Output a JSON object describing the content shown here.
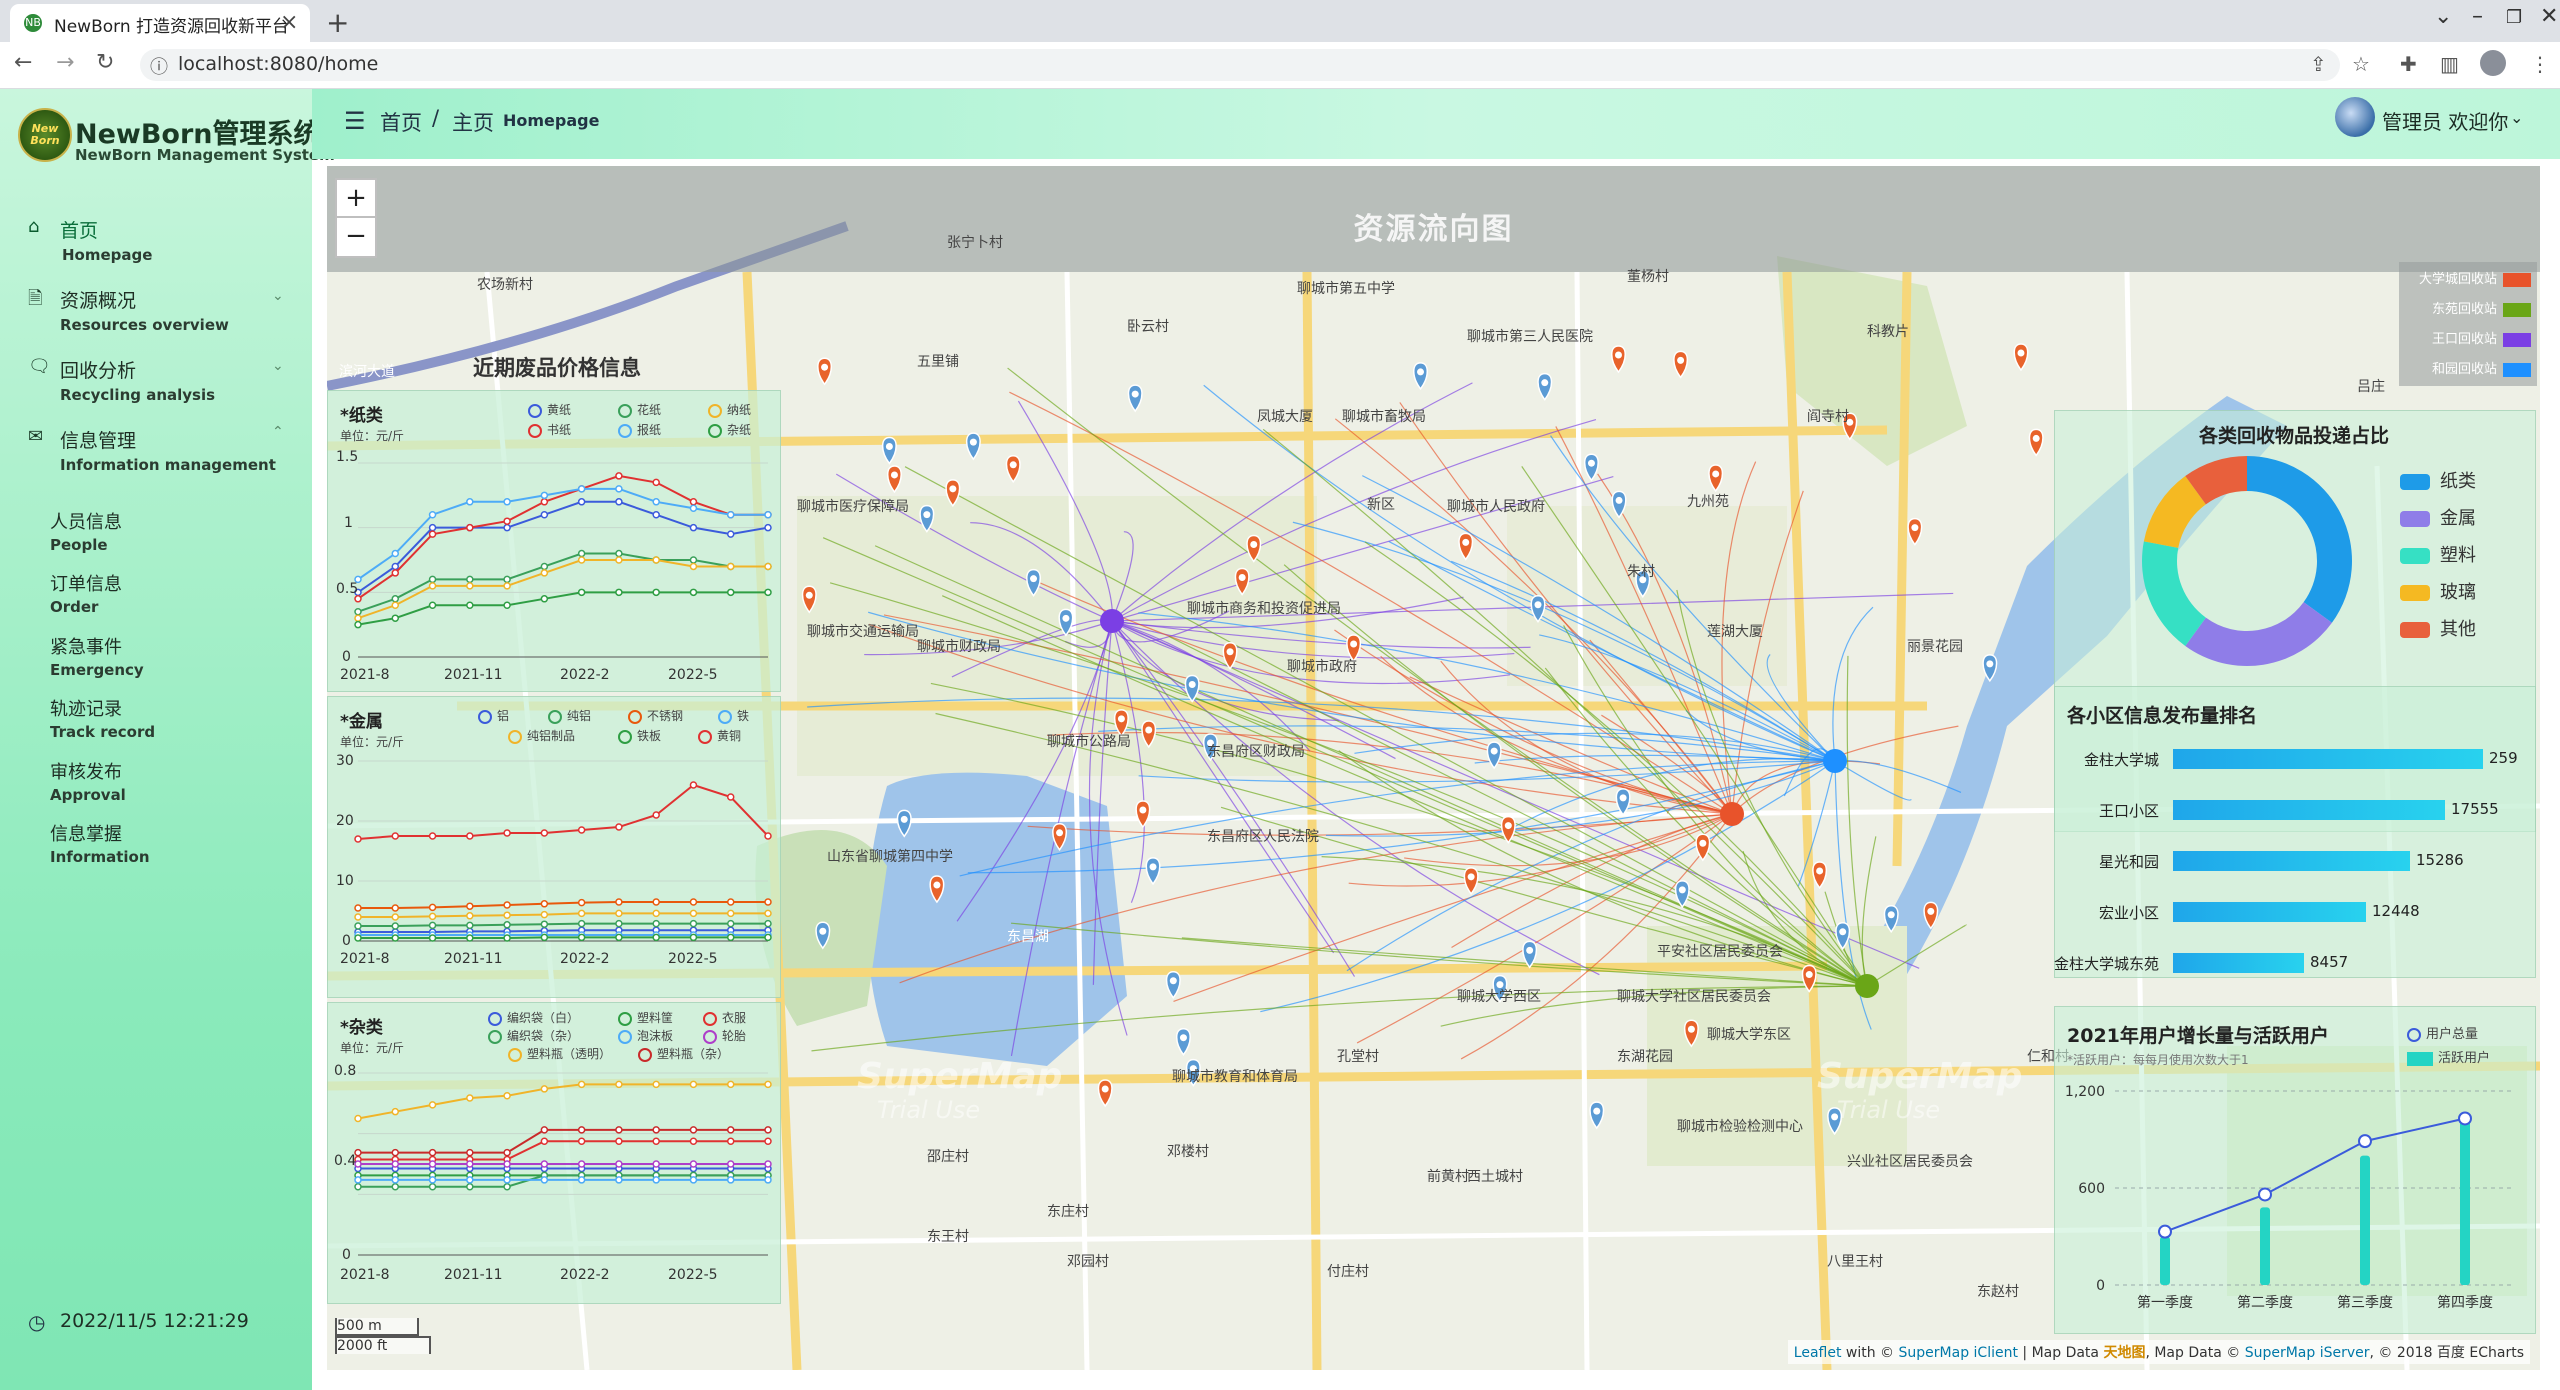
{
  "browser": {
    "tab_title": "NewBorn 打造资源回收新平台",
    "tab_favicon": "NB",
    "url": "localhost:8080/home",
    "new_tab": "+",
    "close": "×"
  },
  "app": {
    "logo_text": "New Born",
    "name": "NewBorn管理系统",
    "name_en": "NewBorn Management System"
  },
  "nav": {
    "items": [
      {
        "label": "首页",
        "sub": "Homepage",
        "icon": "home-icon"
      },
      {
        "label": "资源概况",
        "sub": "Resources overview",
        "icon": "document-icon"
      },
      {
        "label": "回收分析",
        "sub": "Recycling analysis",
        "icon": "chat-chart-icon"
      },
      {
        "label": "信息管理",
        "sub": "Information management",
        "icon": "mail-icon"
      }
    ],
    "children": [
      {
        "label": "人员信息",
        "sub": "People"
      },
      {
        "label": "订单信息",
        "sub": "Order"
      },
      {
        "label": "紧急事件",
        "sub": "Emergency"
      },
      {
        "label": "轨迹记录",
        "sub": "Track record"
      },
      {
        "label": "审核发布",
        "sub": "Approval"
      },
      {
        "label": "信息掌握",
        "sub": "Information"
      }
    ]
  },
  "clock": "2022/11/5 12:21:29",
  "header": {
    "crumb_home": "首页",
    "crumb_sep": "/",
    "crumb_current": "主页",
    "crumb_current_en": "Homepage",
    "user_greeting": "管理员 欢迎你"
  },
  "map": {
    "title": "资源流向图",
    "zoom_in": "+",
    "zoom_out": "−",
    "legend": [
      {
        "name": "大学城回收站",
        "color": "#e8532b"
      },
      {
        "name": "东苑回收站",
        "color": "#6aa617"
      },
      {
        "name": "王口回收站",
        "color": "#7b3fe4"
      },
      {
        "name": "和园回收站",
        "color": "#1e90ff"
      }
    ],
    "scale_m": "500 m",
    "scale_ft": "2000 ft",
    "watermark": "SuperMap",
    "watermark_sub": "Trial Use",
    "attribution": {
      "leaflet": "Leaflet",
      "with": " with © ",
      "iclient": "SuperMap iClient",
      "mapdata": " | Map Data ",
      "tianditu": "天地图",
      "mapdata2": ", Map Data © ",
      "iserver": "SuperMap iServer",
      "echarts": ", © 2018 百度 ECharts"
    },
    "place_labels": [
      "聊城市医疗保障局",
      "聊城市交通运输局",
      "聊城市财政局",
      "聊城市商务和投资促进局",
      "聊城市政府",
      "聊城市公路局",
      "东昌府区财政局",
      "东昌府区人民法院",
      "山东省聊城第四中学",
      "东昌湖",
      "聊城大学西区",
      "平安社区居民委员会",
      "聊城大学社区居民委员会",
      "聊城大学东区",
      "聊城市检验检测中心",
      "兴业社区居民委员会",
      "聊城市教育和体育局",
      "聊城市第三人民医院",
      "聊城市第五中学",
      "聊城市畜牧局",
      "凤城大厦",
      "聊城市人民政府",
      "新区",
      "九州苑",
      "朱村",
      "莲湖大厦",
      "东湖花园",
      "丽景花园",
      "孔堂村",
      "前黄村",
      "付庄村",
      "西土城村",
      "邓楼村",
      "东王村",
      "东庄村",
      "邓园村",
      "邵庄村",
      "八里王村",
      "东赵村",
      "董杨村",
      "阎寺村",
      "吕庄",
      "仁和村",
      "卧云村",
      "五里铺",
      "农场新村",
      "张宁卜村",
      "滨河大道",
      "科教片"
    ]
  },
  "price_panel": {
    "title": "近期废品价格信息",
    "paper": {
      "title": "*纸类",
      "unit": "单位：元/斤",
      "legend": [
        "黄纸",
        "花纸",
        "纳纸",
        "书纸",
        "报纸",
        "杂纸"
      ],
      "x_ticks": [
        "2021-8",
        "2021-11",
        "2022-2",
        "2022-5"
      ],
      "y_ticks": [
        "0",
        "0.5",
        "1",
        "1.5"
      ]
    },
    "metal": {
      "title": "*金属",
      "unit": "单位：元/斤",
      "legend": [
        "铝",
        "纯铝",
        "不锈钢",
        "铁",
        "纯铝制品",
        "铁板",
        "黄铜"
      ],
      "x_ticks": [
        "2021-8",
        "2021-11",
        "2022-2",
        "2022-5"
      ],
      "y_ticks": [
        "0",
        "10",
        "20",
        "30"
      ]
    },
    "misc": {
      "title": "*杂类",
      "unit": "单位：元/斤",
      "legend": [
        "编织袋（白）",
        "塑料筐",
        "衣服",
        "编织袋（杂）",
        "泡沫板",
        "轮胎",
        "塑料瓶（透明）",
        "塑料瓶（杂）"
      ],
      "x_ticks": [
        "2021-8",
        "2021-11",
        "2022-2",
        "2022-5"
      ],
      "y_ticks": [
        "0",
        "0.4",
        "0.8"
      ]
    }
  },
  "chart_data": [
    {
      "type": "line",
      "title": "*纸类",
      "x": [
        "2021-8",
        "2021-9",
        "2021-10",
        "2021-11",
        "2021-12",
        "2022-1",
        "2022-2",
        "2022-3",
        "2022-4",
        "2022-5",
        "2022-6",
        "2022-7"
      ],
      "ylim": [
        0,
        1.5
      ],
      "series": [
        {
          "name": "黄纸",
          "color": "#3b5bdb",
          "values": [
            0.5,
            0.7,
            1.0,
            1.0,
            1.0,
            1.1,
            1.2,
            1.2,
            1.1,
            1.0,
            0.95,
            1.0
          ]
        },
        {
          "name": "花纸",
          "color": "#3aa05a",
          "values": [
            0.35,
            0.45,
            0.6,
            0.6,
            0.6,
            0.7,
            0.8,
            0.8,
            0.75,
            0.75,
            0.7,
            0.7
          ]
        },
        {
          "name": "纳纸",
          "color": "#f0b429",
          "values": [
            0.3,
            0.4,
            0.55,
            0.55,
            0.55,
            0.65,
            0.75,
            0.75,
            0.75,
            0.7,
            0.7,
            0.7
          ]
        },
        {
          "name": "书纸",
          "color": "#e03131",
          "values": [
            0.45,
            0.65,
            0.95,
            1.0,
            1.05,
            1.2,
            1.3,
            1.4,
            1.35,
            1.2,
            1.1,
            1.1
          ]
        },
        {
          "name": "报纸",
          "color": "#4dabf7",
          "values": [
            0.6,
            0.8,
            1.1,
            1.2,
            1.2,
            1.25,
            1.3,
            1.3,
            1.2,
            1.15,
            1.1,
            1.1
          ]
        },
        {
          "name": "杂纸",
          "color": "#2f9e44",
          "values": [
            0.25,
            0.3,
            0.4,
            0.4,
            0.4,
            0.45,
            0.5,
            0.5,
            0.5,
            0.5,
            0.5,
            0.5
          ]
        }
      ]
    },
    {
      "type": "line",
      "title": "*金属",
      "x": [
        "2021-8",
        "2021-9",
        "2021-10",
        "2021-11",
        "2021-12",
        "2022-1",
        "2022-2",
        "2022-3",
        "2022-4",
        "2022-5",
        "2022-6",
        "2022-7"
      ],
      "ylim": [
        0,
        30
      ],
      "series": [
        {
          "name": "铝",
          "color": "#3b5bdb",
          "values": [
            1.5,
            1.5,
            1.5,
            1.6,
            1.6,
            1.7,
            1.8,
            1.8,
            1.8,
            1.8,
            1.8,
            1.8
          ]
        },
        {
          "name": "纯铝",
          "color": "#3aa05a",
          "values": [
            2.5,
            2.5,
            2.6,
            2.6,
            2.7,
            2.8,
            2.9,
            2.9,
            2.9,
            2.9,
            2.9,
            2.9
          ]
        },
        {
          "name": "不锈钢",
          "color": "#e8590c",
          "values": [
            5.5,
            5.5,
            5.6,
            5.8,
            6.0,
            6.2,
            6.4,
            6.5,
            6.5,
            6.5,
            6.5,
            6.5
          ]
        },
        {
          "name": "铁",
          "color": "#4dabf7",
          "values": [
            1.0,
            1.0,
            1.0,
            1.0,
            1.0,
            1.0,
            1.0,
            1.0,
            1.0,
            1.0,
            1.0,
            1.0
          ]
        },
        {
          "name": "纯铝制品",
          "color": "#f0b429",
          "values": [
            4.0,
            4.0,
            4.1,
            4.2,
            4.3,
            4.4,
            4.6,
            4.6,
            4.6,
            4.6,
            4.6,
            4.6
          ]
        },
        {
          "name": "铁板",
          "color": "#2f9e44",
          "values": [
            0.5,
            0.5,
            0.5,
            0.5,
            0.5,
            0.6,
            0.6,
            0.6,
            0.6,
            0.6,
            0.6,
            0.6
          ]
        },
        {
          "name": "黄铜",
          "color": "#e03131",
          "values": [
            17,
            17.5,
            17.5,
            17.5,
            18,
            18,
            18.5,
            19,
            21,
            26,
            24,
            17.5
          ]
        }
      ]
    },
    {
      "type": "line",
      "title": "*杂类",
      "x": [
        "2021-8",
        "2021-9",
        "2021-10",
        "2021-11",
        "2021-12",
        "2022-1",
        "2022-2",
        "2022-3",
        "2022-4",
        "2022-5",
        "2022-6",
        "2022-7"
      ],
      "ylim": [
        0,
        0.8
      ],
      "series": [
        {
          "name": "编织袋（白）",
          "color": "#3b5bdb",
          "values": [
            0.38,
            0.38,
            0.38,
            0.38,
            0.38,
            0.38,
            0.38,
            0.38,
            0.38,
            0.38,
            0.38,
            0.38
          ]
        },
        {
          "name": "塑料筐",
          "color": "#2f9e44",
          "values": [
            0.35,
            0.35,
            0.35,
            0.35,
            0.35,
            0.35,
            0.35,
            0.35,
            0.35,
            0.35,
            0.35,
            0.35
          ]
        },
        {
          "name": "衣服",
          "color": "#e03131",
          "values": [
            0.42,
            0.42,
            0.42,
            0.42,
            0.42,
            0.5,
            0.5,
            0.5,
            0.5,
            0.5,
            0.5,
            0.5
          ]
        },
        {
          "name": "编织袋（杂）",
          "color": "#3aa05a",
          "values": [
            0.3,
            0.3,
            0.3,
            0.3,
            0.3,
            0.35,
            0.35,
            0.35,
            0.35,
            0.35,
            0.35,
            0.35
          ]
        },
        {
          "name": "泡沫板",
          "color": "#4dabf7",
          "values": [
            0.33,
            0.33,
            0.33,
            0.33,
            0.33,
            0.33,
            0.33,
            0.33,
            0.33,
            0.33,
            0.33,
            0.33
          ]
        },
        {
          "name": "轮胎",
          "color": "#ae3ec9",
          "values": [
            0.4,
            0.4,
            0.4,
            0.4,
            0.4,
            0.4,
            0.4,
            0.4,
            0.4,
            0.4,
            0.4,
            0.4
          ]
        },
        {
          "name": "塑料瓶（透明）",
          "color": "#f0b429",
          "values": [
            0.6,
            0.63,
            0.66,
            0.69,
            0.7,
            0.73,
            0.75,
            0.75,
            0.75,
            0.75,
            0.75,
            0.75
          ]
        },
        {
          "name": "塑料瓶（杂）",
          "color": "#c92a2a",
          "values": [
            0.45,
            0.45,
            0.45,
            0.45,
            0.45,
            0.55,
            0.55,
            0.55,
            0.55,
            0.55,
            0.55,
            0.55
          ]
        }
      ]
    },
    {
      "type": "pie",
      "title": "各类回收物品投递占比",
      "series": [
        {
          "name": "纸类",
          "color": "#1e9be8",
          "value": 35
        },
        {
          "name": "金属",
          "color": "#8f7de8",
          "value": 25
        },
        {
          "name": "塑料",
          "color": "#36e0c4",
          "value": 18
        },
        {
          "name": "玻璃",
          "color": "#f5b922",
          "value": 12
        },
        {
          "name": "其他",
          "color": "#e8603c",
          "value": 10
        }
      ]
    },
    {
      "type": "bar",
      "title": "各小区信息发布量排名",
      "categories": [
        "金柱大学城",
        "王口小区",
        "星光和园",
        "宏业小区",
        "金柱大学城东苑"
      ],
      "values": [
        259,
        17555,
        15286,
        12448,
        8457
      ],
      "labels": [
        "259",
        "17555",
        "15286",
        "12448",
        "8457"
      ]
    },
    {
      "type": "bar",
      "title": "2021年用户增长量与活跃用户",
      "subtitle": "*活跃用户：每每月使用次数大于1",
      "categories": [
        "第一季度",
        "第二季度",
        "第三季度",
        "第四季度"
      ],
      "ylim": [
        0,
        1200
      ],
      "y_ticks": [
        "0",
        "600",
        "1,200"
      ],
      "series": [
        {
          "name": "用户总量",
          "type": "line",
          "color": "#3b5bdb",
          "values": [
            330,
            560,
            890,
            1030
          ]
        },
        {
          "name": "活跃用户",
          "type": "bar",
          "color": "#24d4c4",
          "values": [
            300,
            480,
            800,
            1040
          ]
        }
      ]
    }
  ]
}
